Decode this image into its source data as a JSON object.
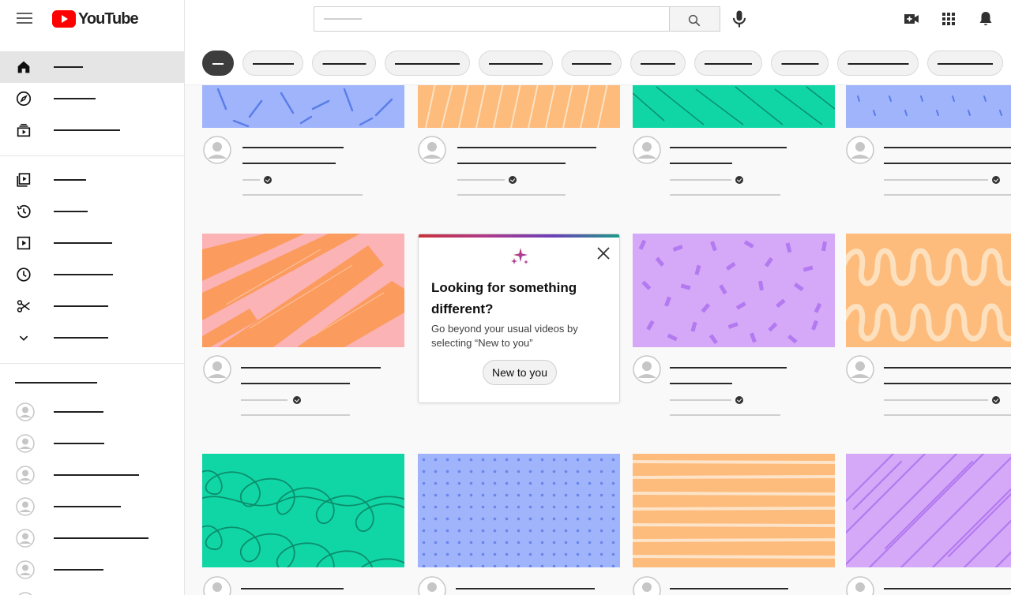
{
  "header": {
    "logo_text": "YouTube",
    "logo_red": "#ff0000"
  },
  "promo": {
    "title": "Looking for something different?",
    "description": "Go beyond your usual videos by selecting “New to you”",
    "button_label": "New to you"
  },
  "icons": {
    "menu": "hamburger-icon",
    "search": "search-icon",
    "mic": "mic-icon",
    "create": "create-video-icon",
    "apps": "apps-icon",
    "notifications": "bell-icon",
    "home": "home-icon",
    "explore": "explore-icon",
    "subscriptions": "subscriptions-icon",
    "library": "library-icon",
    "history": "history-icon",
    "your_videos": "your-videos-icon",
    "watch_later": "watch-later-icon",
    "clips": "clips-icon",
    "show_more": "chevron-down-icon",
    "sparkle": "sparkle-icon",
    "close": "close-icon"
  },
  "colors": {
    "thumb_blue": "#9fb4fb",
    "thumb_orange": "#fdbb7c",
    "thumb_green": "#10d6a6",
    "thumb_pink": "#fbb3b6",
    "thumb_purple": "#d5a9f7",
    "promo_gradient_start": "#c9323a",
    "promo_gradient_end": "#1d9a8a"
  }
}
